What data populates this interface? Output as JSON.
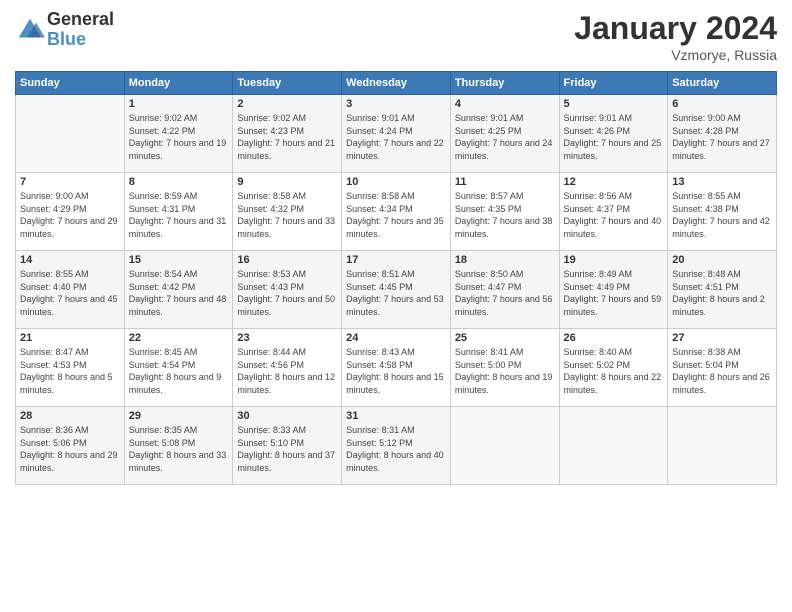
{
  "logo": {
    "general": "General",
    "blue": "Blue"
  },
  "title": "January 2024",
  "location": "Vzmorye, Russia",
  "days_header": [
    "Sunday",
    "Monday",
    "Tuesday",
    "Wednesday",
    "Thursday",
    "Friday",
    "Saturday"
  ],
  "weeks": [
    [
      {
        "day": "",
        "sunrise": "",
        "sunset": "",
        "daylight": ""
      },
      {
        "day": "1",
        "sunrise": "Sunrise: 9:02 AM",
        "sunset": "Sunset: 4:22 PM",
        "daylight": "Daylight: 7 hours and 19 minutes."
      },
      {
        "day": "2",
        "sunrise": "Sunrise: 9:02 AM",
        "sunset": "Sunset: 4:23 PM",
        "daylight": "Daylight: 7 hours and 21 minutes."
      },
      {
        "day": "3",
        "sunrise": "Sunrise: 9:01 AM",
        "sunset": "Sunset: 4:24 PM",
        "daylight": "Daylight: 7 hours and 22 minutes."
      },
      {
        "day": "4",
        "sunrise": "Sunrise: 9:01 AM",
        "sunset": "Sunset: 4:25 PM",
        "daylight": "Daylight: 7 hours and 24 minutes."
      },
      {
        "day": "5",
        "sunrise": "Sunrise: 9:01 AM",
        "sunset": "Sunset: 4:26 PM",
        "daylight": "Daylight: 7 hours and 25 minutes."
      },
      {
        "day": "6",
        "sunrise": "Sunrise: 9:00 AM",
        "sunset": "Sunset: 4:28 PM",
        "daylight": "Daylight: 7 hours and 27 minutes."
      }
    ],
    [
      {
        "day": "7",
        "sunrise": "Sunrise: 9:00 AM",
        "sunset": "Sunset: 4:29 PM",
        "daylight": "Daylight: 7 hours and 29 minutes."
      },
      {
        "day": "8",
        "sunrise": "Sunrise: 8:59 AM",
        "sunset": "Sunset: 4:31 PM",
        "daylight": "Daylight: 7 hours and 31 minutes."
      },
      {
        "day": "9",
        "sunrise": "Sunrise: 8:58 AM",
        "sunset": "Sunset: 4:32 PM",
        "daylight": "Daylight: 7 hours and 33 minutes."
      },
      {
        "day": "10",
        "sunrise": "Sunrise: 8:58 AM",
        "sunset": "Sunset: 4:34 PM",
        "daylight": "Daylight: 7 hours and 35 minutes."
      },
      {
        "day": "11",
        "sunrise": "Sunrise: 8:57 AM",
        "sunset": "Sunset: 4:35 PM",
        "daylight": "Daylight: 7 hours and 38 minutes."
      },
      {
        "day": "12",
        "sunrise": "Sunrise: 8:56 AM",
        "sunset": "Sunset: 4:37 PM",
        "daylight": "Daylight: 7 hours and 40 minutes."
      },
      {
        "day": "13",
        "sunrise": "Sunrise: 8:55 AM",
        "sunset": "Sunset: 4:38 PM",
        "daylight": "Daylight: 7 hours and 42 minutes."
      }
    ],
    [
      {
        "day": "14",
        "sunrise": "Sunrise: 8:55 AM",
        "sunset": "Sunset: 4:40 PM",
        "daylight": "Daylight: 7 hours and 45 minutes."
      },
      {
        "day": "15",
        "sunrise": "Sunrise: 8:54 AM",
        "sunset": "Sunset: 4:42 PM",
        "daylight": "Daylight: 7 hours and 48 minutes."
      },
      {
        "day": "16",
        "sunrise": "Sunrise: 8:53 AM",
        "sunset": "Sunset: 4:43 PM",
        "daylight": "Daylight: 7 hours and 50 minutes."
      },
      {
        "day": "17",
        "sunrise": "Sunrise: 8:51 AM",
        "sunset": "Sunset: 4:45 PM",
        "daylight": "Daylight: 7 hours and 53 minutes."
      },
      {
        "day": "18",
        "sunrise": "Sunrise: 8:50 AM",
        "sunset": "Sunset: 4:47 PM",
        "daylight": "Daylight: 7 hours and 56 minutes."
      },
      {
        "day": "19",
        "sunrise": "Sunrise: 8:49 AM",
        "sunset": "Sunset: 4:49 PM",
        "daylight": "Daylight: 7 hours and 59 minutes."
      },
      {
        "day": "20",
        "sunrise": "Sunrise: 8:48 AM",
        "sunset": "Sunset: 4:51 PM",
        "daylight": "Daylight: 8 hours and 2 minutes."
      }
    ],
    [
      {
        "day": "21",
        "sunrise": "Sunrise: 8:47 AM",
        "sunset": "Sunset: 4:53 PM",
        "daylight": "Daylight: 8 hours and 5 minutes."
      },
      {
        "day": "22",
        "sunrise": "Sunrise: 8:45 AM",
        "sunset": "Sunset: 4:54 PM",
        "daylight": "Daylight: 8 hours and 9 minutes."
      },
      {
        "day": "23",
        "sunrise": "Sunrise: 8:44 AM",
        "sunset": "Sunset: 4:56 PM",
        "daylight": "Daylight: 8 hours and 12 minutes."
      },
      {
        "day": "24",
        "sunrise": "Sunrise: 8:43 AM",
        "sunset": "Sunset: 4:58 PM",
        "daylight": "Daylight: 8 hours and 15 minutes."
      },
      {
        "day": "25",
        "sunrise": "Sunrise: 8:41 AM",
        "sunset": "Sunset: 5:00 PM",
        "daylight": "Daylight: 8 hours and 19 minutes."
      },
      {
        "day": "26",
        "sunrise": "Sunrise: 8:40 AM",
        "sunset": "Sunset: 5:02 PM",
        "daylight": "Daylight: 8 hours and 22 minutes."
      },
      {
        "day": "27",
        "sunrise": "Sunrise: 8:38 AM",
        "sunset": "Sunset: 5:04 PM",
        "daylight": "Daylight: 8 hours and 26 minutes."
      }
    ],
    [
      {
        "day": "28",
        "sunrise": "Sunrise: 8:36 AM",
        "sunset": "Sunset: 5:06 PM",
        "daylight": "Daylight: 8 hours and 29 minutes."
      },
      {
        "day": "29",
        "sunrise": "Sunrise: 8:35 AM",
        "sunset": "Sunset: 5:08 PM",
        "daylight": "Daylight: 8 hours and 33 minutes."
      },
      {
        "day": "30",
        "sunrise": "Sunrise: 8:33 AM",
        "sunset": "Sunset: 5:10 PM",
        "daylight": "Daylight: 8 hours and 37 minutes."
      },
      {
        "day": "31",
        "sunrise": "Sunrise: 8:31 AM",
        "sunset": "Sunset: 5:12 PM",
        "daylight": "Daylight: 8 hours and 40 minutes."
      },
      {
        "day": "",
        "sunrise": "",
        "sunset": "",
        "daylight": ""
      },
      {
        "day": "",
        "sunrise": "",
        "sunset": "",
        "daylight": ""
      },
      {
        "day": "",
        "sunrise": "",
        "sunset": "",
        "daylight": ""
      }
    ]
  ]
}
